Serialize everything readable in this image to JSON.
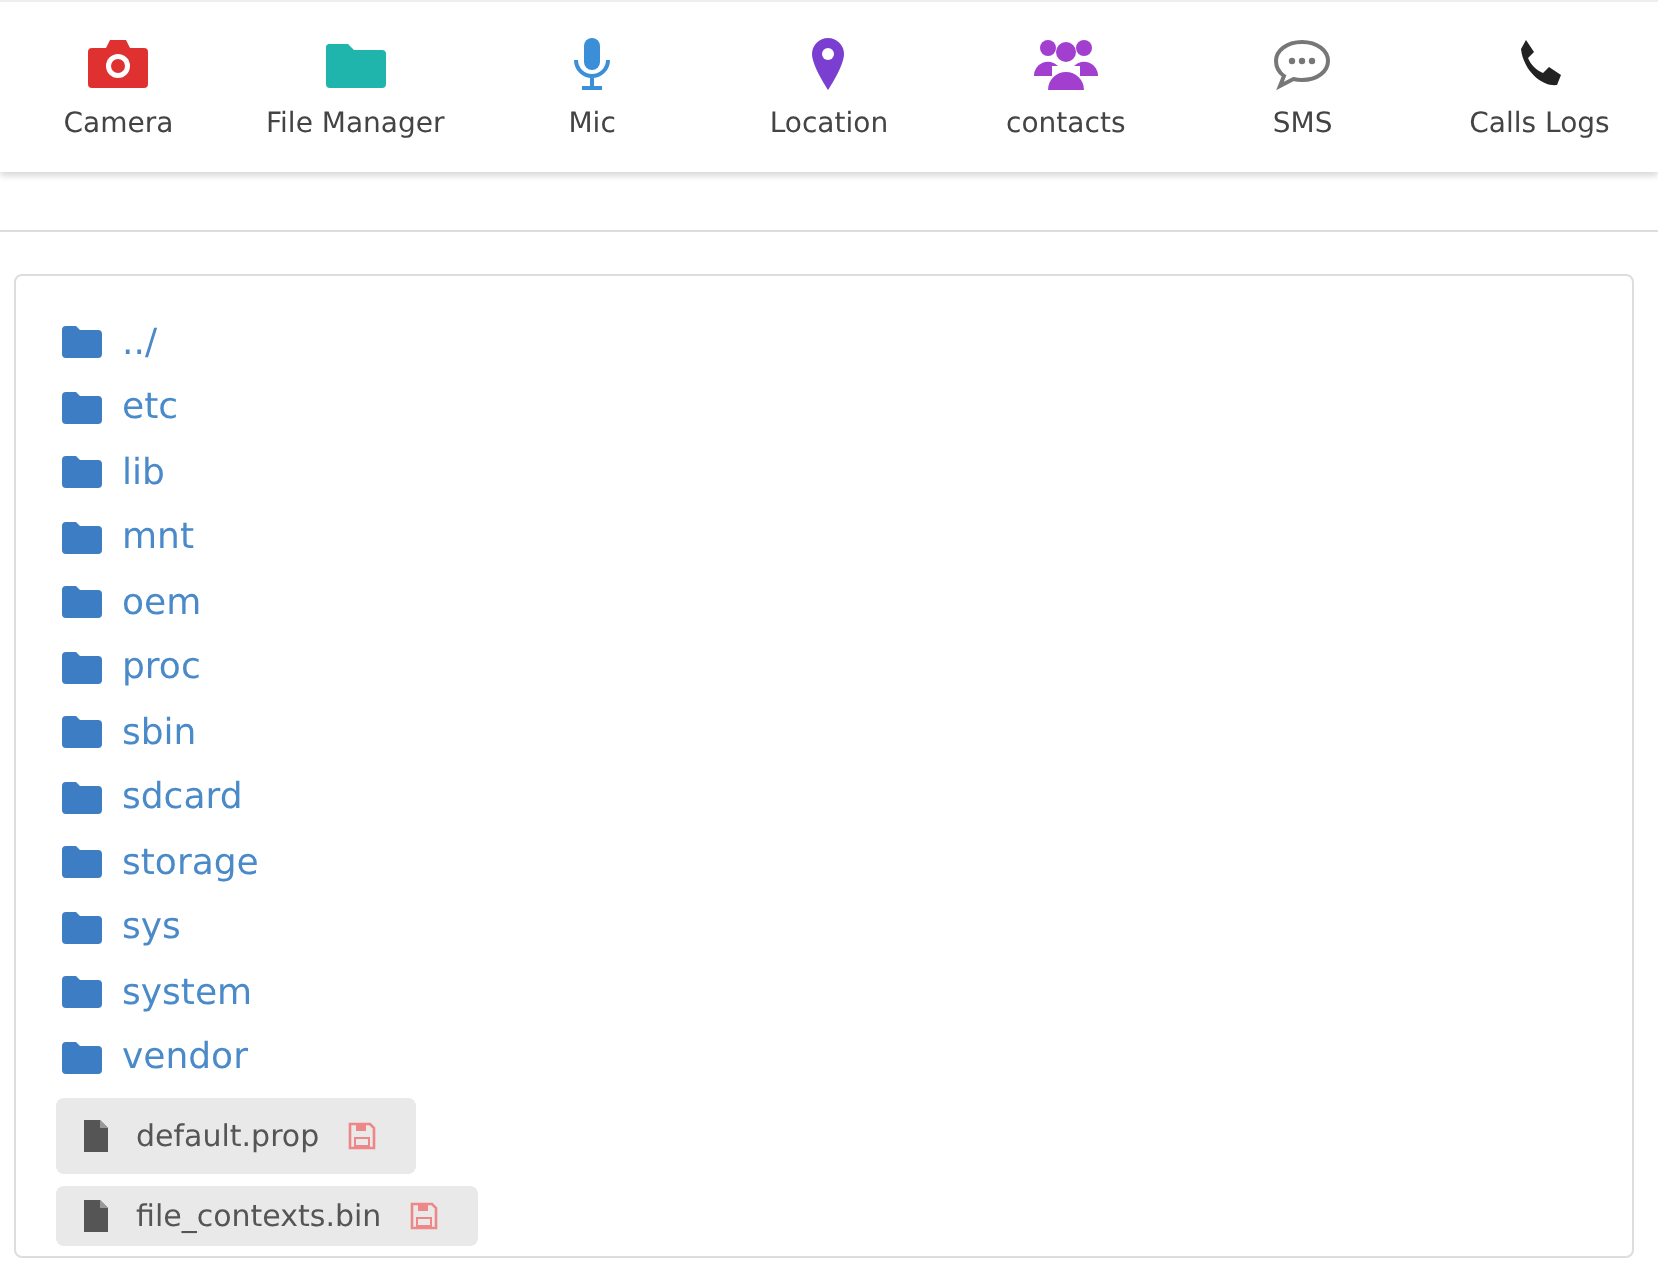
{
  "nav": [
    {
      "label": "Camera"
    },
    {
      "label": "File Manager"
    },
    {
      "label": "Mic"
    },
    {
      "label": "Location"
    },
    {
      "label": "contacts"
    },
    {
      "label": "SMS"
    },
    {
      "label": "Calls Logs"
    }
  ],
  "folders": [
    "../",
    "etc",
    "lib",
    "mnt",
    "oem",
    "proc",
    "sbin",
    "sdcard",
    "storage",
    "sys",
    "system",
    "vendor"
  ],
  "files": [
    "default.prop",
    "file_contexts.bin"
  ]
}
